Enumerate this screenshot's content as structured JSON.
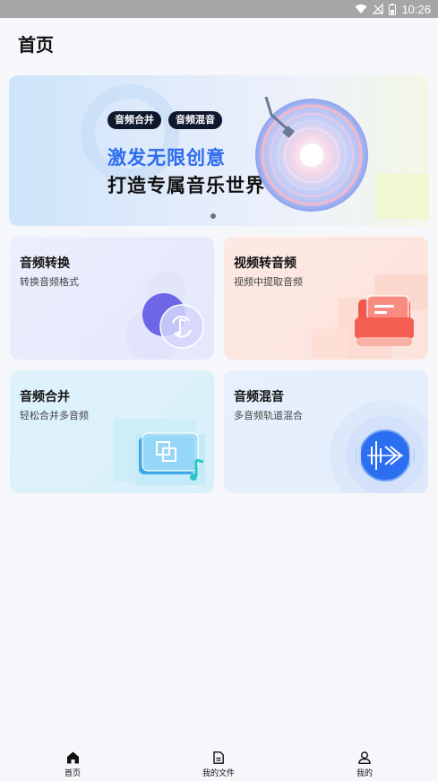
{
  "status_bar": {
    "time": "10:26",
    "icons": [
      "wifi-icon",
      "signal-off-icon",
      "battery-icon"
    ]
  },
  "header": {
    "title": "首页"
  },
  "banner": {
    "tags": [
      "音频合并",
      "音频混音"
    ],
    "headline": "激发无限创意",
    "subheadline": "打造专属音乐世界",
    "carousel_index": 1,
    "carousel_count": 1
  },
  "cards": [
    {
      "title": "音频转换",
      "subtitle": "转换音频格式",
      "icon": "audio-convert-icon"
    },
    {
      "title": "视频转音频",
      "subtitle": "视频中提取音频",
      "icon": "video-to-audio-icon"
    },
    {
      "title": "音频合并",
      "subtitle": "轻松合并多音频",
      "icon": "audio-merge-icon"
    },
    {
      "title": "音频混音",
      "subtitle": "多音频轨道混合",
      "icon": "audio-mix-icon"
    }
  ],
  "bottom_nav": {
    "items": [
      {
        "label": "首页",
        "icon": "home-icon",
        "active": true
      },
      {
        "label": "我的文件",
        "icon": "file-icon",
        "active": false
      },
      {
        "label": "我的",
        "icon": "user-icon",
        "active": false
      }
    ]
  },
  "colors": {
    "accent_blue": "#2d6cf0",
    "tag_bg": "#10182e",
    "page_bg": "#f6f7fb"
  }
}
